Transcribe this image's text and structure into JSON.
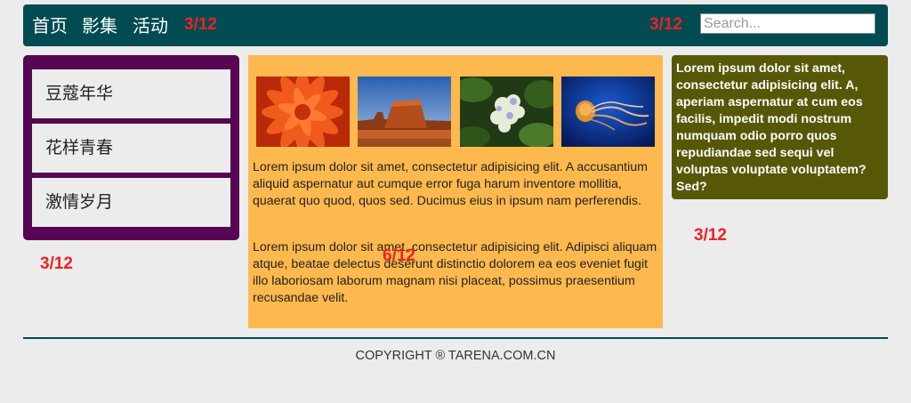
{
  "nav": {
    "items": [
      "首页",
      "影集",
      "活动"
    ],
    "grid_label_left": "3/12",
    "grid_label_right": "3/12",
    "search_placeholder": "Search..."
  },
  "sidebar": {
    "items": [
      "豆蔻年华",
      "花样青春",
      "激情岁月"
    ],
    "grid_label": "3/12"
  },
  "main": {
    "images": [
      "chrysanthemum-photo",
      "desert-butte-photo",
      "hydrangea-photo",
      "jellyfish-photo"
    ],
    "paragraphs": [
      "Lorem ipsum dolor sit amet, consectetur adipisicing elit. A accusantium aliquid aspernatur aut cumque error fuga harum inventore mollitia, quaerat quo quod, quos sed. Ducimus eius in ipsum nam perferendis.",
      "Lorem ipsum dolor sit amet, consectetur adipisicing elit. Adipisci aliquam atque, beatae delectus deserunt distinctio dolorem ea eos eveniet fugit illo laboriosam laborum magnam nisi placeat, possimus praesentium recusandae velit."
    ],
    "grid_label": "6/12"
  },
  "aside": {
    "text": "Lorem ipsum dolor sit amet, consectetur adipisicing elit. A, aperiam aspernatur at cum eos facilis, impedit modi nostrum numquam odio porro quos repudiandae sed sequi vel voluptas voluptate voluptatem? Sed?",
    "grid_label": "3/12"
  },
  "footer": {
    "copyright": "COPYRIGHT ® TARENA.COM.CN"
  },
  "colors": {
    "topbar": "#004c52",
    "sidebar": "#560652",
    "main": "#fdb94d",
    "aside": "#565808",
    "grid_label": "#ee2222"
  }
}
